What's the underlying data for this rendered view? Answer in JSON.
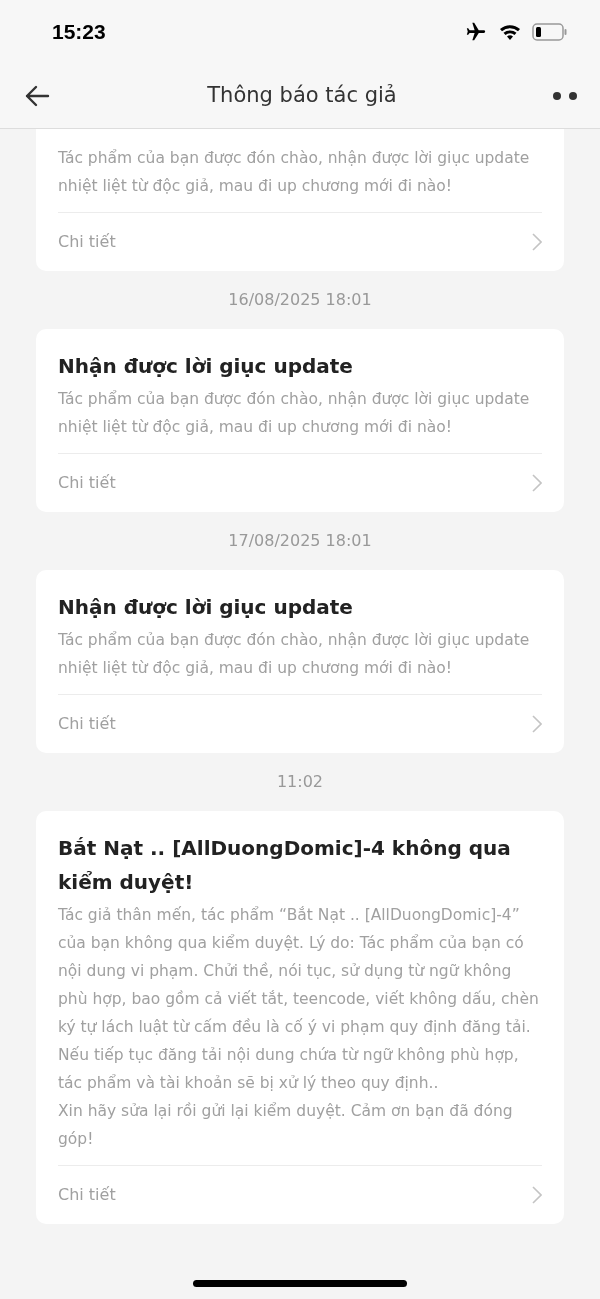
{
  "status_bar": {
    "time": "15:23"
  },
  "header": {
    "title": "Thông báo tác giả"
  },
  "notifications": [
    {
      "body": "Tác phẩm của bạn được đón chào, nhận được lời giục update nhiệt liệt từ độc giả, mau đi up chương mới đi nào!",
      "link": "Chi tiết"
    },
    {
      "time": "16/08/2025 18:01",
      "title": "Nhận được lời giục update",
      "body": "Tác phẩm của bạn được đón chào, nhận được lời giục update nhiệt liệt từ độc giả, mau đi up chương mới đi nào!",
      "link": "Chi tiết"
    },
    {
      "time": "17/08/2025 18:01",
      "title": "Nhận được lời giục update",
      "body": "Tác phẩm của bạn được đón chào, nhận được lời giục update nhiệt liệt từ độc giả, mau đi up chương mới đi nào!",
      "link": "Chi tiết"
    },
    {
      "time": "11:02",
      "title": "Bắt Nạt .. [AllDuongDomic]-4 không qua kiểm duyệt!",
      "body": "Tác giả thân mến, tác phẩm “Bắt Nạt .. [AllDuongDomic]-4” của bạn không qua kiểm duyệt. Lý do: Tác phẩm của bạn có nội dung vi phạm. Chửi thề, nói tục, sử dụng từ ngữ không phù hợp, bao gồm cả viết tắt, teencode, viết không dấu, chèn ký tự lách luật từ cấm đều là cố ý vi phạm quy định đăng tải. Nếu tiếp tục đăng tải nội dung chứa từ ngữ không phù hợp, tác phẩm và tài khoản sẽ bị xử lý theo quy định..\nXin hãy sửa lại rồi gửi lại kiểm duyệt. Cảm ơn bạn đã đóng góp!",
      "link": "Chi tiết"
    }
  ]
}
